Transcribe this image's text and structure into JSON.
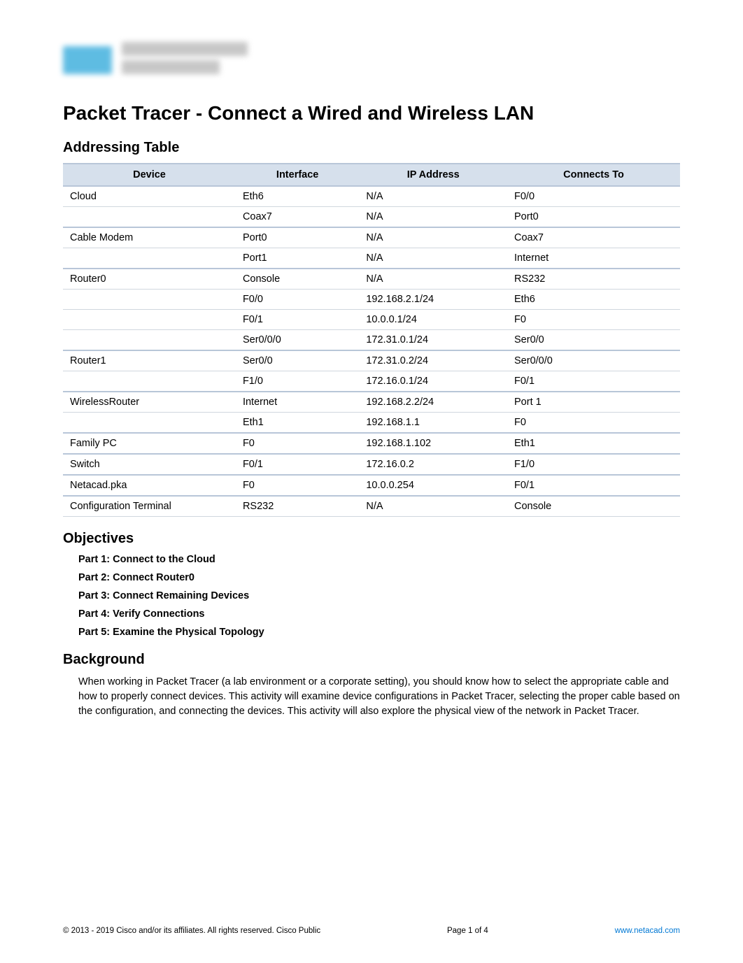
{
  "logo": {
    "brand": "Cisco Networking Academy"
  },
  "title": "Packet Tracer - Connect a Wired and Wireless LAN",
  "sections": {
    "addressing_heading": "Addressing Table",
    "objectives_heading": "Objectives",
    "background_heading": "Background"
  },
  "table": {
    "headers": {
      "device": "Device",
      "interface": "Interface",
      "ip": "IP Address",
      "connects": "Connects To"
    },
    "rows": [
      {
        "device": "Cloud",
        "interface": "Eth6",
        "ip": "N/A",
        "connects": "F0/0",
        "group_start": true
      },
      {
        "device": "",
        "interface": "Coax7",
        "ip": "N/A",
        "connects": "Port0"
      },
      {
        "device": "Cable Modem",
        "interface": "Port0",
        "ip": "N/A",
        "connects": "Coax7",
        "group_start": true
      },
      {
        "device": "",
        "interface": "Port1",
        "ip": "N/A",
        "connects": "Internet"
      },
      {
        "device": "Router0",
        "interface": "Console",
        "ip": "N/A",
        "connects": "RS232",
        "group_start": true
      },
      {
        "device": "",
        "interface": "F0/0",
        "ip": "192.168.2.1/24",
        "connects": "Eth6"
      },
      {
        "device": "",
        "interface": "F0/1",
        "ip": "10.0.0.1/24",
        "connects": "F0"
      },
      {
        "device": "",
        "interface": "Ser0/0/0",
        "ip": "172.31.0.1/24",
        "connects": "Ser0/0"
      },
      {
        "device": "Router1",
        "interface": "Ser0/0",
        "ip": "172.31.0.2/24",
        "connects": "Ser0/0/0",
        "group_start": true
      },
      {
        "device": "",
        "interface": "F1/0",
        "ip": "172.16.0.1/24",
        "connects": "F0/1"
      },
      {
        "device": "WirelessRouter",
        "interface": "Internet",
        "ip": "192.168.2.2/24",
        "connects": "Port 1",
        "group_start": true
      },
      {
        "device": "",
        "interface": "Eth1",
        "ip": "192.168.1.1",
        "connects": "F0"
      },
      {
        "device": "Family PC",
        "interface": "F0",
        "ip": "192.168.1.102",
        "connects": "Eth1",
        "group_start": true
      },
      {
        "device": "Switch",
        "interface": "F0/1",
        "ip": "172.16.0.2",
        "connects": "F1/0",
        "group_start": true
      },
      {
        "device": "Netacad.pka",
        "interface": "F0",
        "ip": "10.0.0.254",
        "connects": "F0/1",
        "group_start": true
      },
      {
        "device": "Configuration Terminal",
        "interface": "RS232",
        "ip": "N/A",
        "connects": "Console",
        "group_start": true
      }
    ]
  },
  "objectives": [
    "Part 1: Connect to the Cloud",
    "Part 2: Connect Router0",
    "Part 3: Connect Remaining Devices",
    "Part 4: Verify Connections",
    "Part 5: Examine the Physical Topology"
  ],
  "background_text": "When working in Packet Tracer (a lab environment or a corporate setting), you should know how to select the appropriate cable and how to properly connect devices. This activity will examine device configurations in Packet Tracer, selecting the proper cable based on the configuration, and connecting the devices. This activity will also explore the physical view of the network in Packet Tracer.",
  "footer": {
    "copyright": "© 2013 - 2019 Cisco and/or its affiliates. All rights reserved. Cisco Public",
    "page": "Page 1 of 4",
    "url": "www.netacad.com"
  }
}
